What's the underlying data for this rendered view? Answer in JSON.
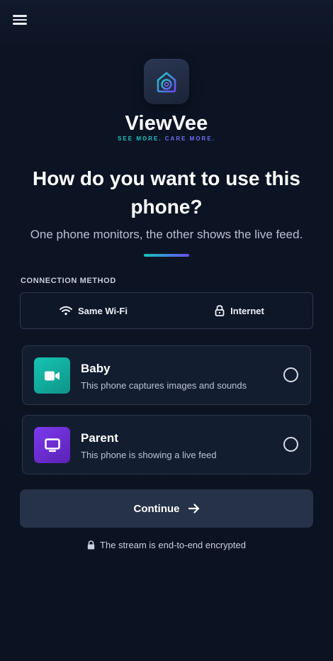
{
  "header": {
    "menu_icon": "hamburger-menu-icon"
  },
  "brand": {
    "name": "ViewVee",
    "tagline_part1": "SEE MORE.",
    "tagline_part2": "CARE MORE.",
    "logo_icon": "home-camera-logo-icon",
    "colors": {
      "teal": "#1fc3c0",
      "violet": "#6b6ff0"
    }
  },
  "main": {
    "headline": "How do you want to use this phone?",
    "subtitle": "One phone monitors, the other shows the live feed."
  },
  "connection": {
    "section_label": "CONNECTION METHOD",
    "options": [
      {
        "label": "Same Wi-Fi",
        "icon": "wifi-icon"
      },
      {
        "label": "Internet",
        "icon": "lock-icon"
      }
    ]
  },
  "roles": [
    {
      "title": "Baby",
      "description": "This phone captures images and sounds",
      "icon": "video-camera-icon",
      "color": "#14b8a6",
      "selected": false
    },
    {
      "title": "Parent",
      "description": "This phone is showing a live feed",
      "icon": "monitor-icon",
      "color": "#7c3aed",
      "selected": false
    }
  ],
  "actions": {
    "continue_label": "Continue",
    "continue_icon": "arrow-right-icon"
  },
  "footer": {
    "secure_text": "The stream is end-to-end encrypted",
    "secure_icon": "lock-icon"
  }
}
